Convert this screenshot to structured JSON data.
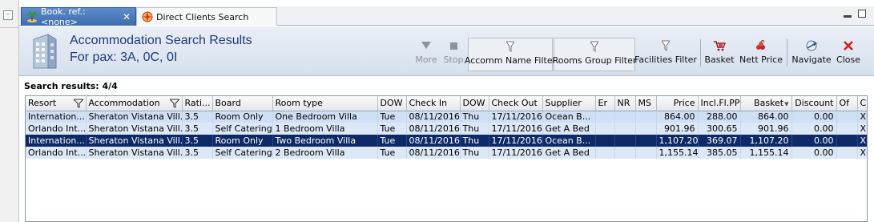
{
  "tabs": [
    {
      "label": "Book. ref.: <none>",
      "icon": "palm-island-icon",
      "active": true,
      "close": "✕"
    },
    {
      "label": "Direct Clients Search",
      "icon": "compass-star-icon",
      "active": false
    }
  ],
  "header": {
    "title": "Accommodation Search Results",
    "subtitle": "For pax: 3A, 0C, 0I"
  },
  "toolbar": {
    "more": "More",
    "stop": "Stop",
    "accomm_name_filter": "Accomm Name Filter",
    "rooms_group_filter": "Rooms Group Filter",
    "facilities_filter": "Facilities Filter",
    "basket": "Basket",
    "nett_price": "Nett Price",
    "navigate": "Navigate",
    "close": "Close"
  },
  "results_label": "Search results: 4/4",
  "columns": [
    "Resort",
    "Accommodation",
    "Rati...",
    "Board",
    "Room type",
    "DOW",
    "Check In",
    "DOW",
    "Check Out",
    "Supplier",
    "Er",
    "NR",
    "MS",
    "Price",
    "Incl.Fl.PP",
    "Basket",
    "Discount",
    "Of",
    "C"
  ],
  "rows": [
    [
      "Internation...",
      "Sheraton Vistana Vill...",
      "3.5",
      "Room Only",
      "One Bedroom Villa",
      "Tue",
      "08/11/2016",
      "Thu",
      "17/11/2016",
      "Ocean B...",
      "",
      "",
      "",
      "864.00",
      "288.00",
      "864.00",
      "0.00",
      "",
      "X"
    ],
    [
      "Orlando Int...",
      "Sheraton Vistana Vill...",
      "3.5",
      "Self Catering",
      "1 Bedroom Villa",
      "Tue",
      "08/11/2016",
      "Thu",
      "17/11/2016",
      "Get A Bed",
      "",
      "",
      "",
      "901.96",
      "300.65",
      "901.96",
      "0.00",
      "",
      "X"
    ],
    [
      "Internation...",
      "Sheraton Vistana Vill...",
      "3.5",
      "Room Only",
      "Two Bedroom Villa",
      "Tue",
      "08/11/2016",
      "Thu",
      "17/11/2016",
      "Ocean B...",
      "",
      "",
      "",
      "1,107.20",
      "369.07",
      "1,107.20",
      "0.00",
      "",
      "X"
    ],
    [
      "Orlando Int...",
      "Sheraton Vistana Vill...",
      "3.5",
      "Self Catering",
      "2 Bedroom Villa",
      "Tue",
      "08/11/2016",
      "Thu",
      "17/11/2016",
      "Get A Bed",
      "",
      "",
      "",
      "1,155.14",
      "385.05",
      "1,155.14",
      "0.00",
      "",
      "X"
    ]
  ],
  "colors": {
    "selected_row": "#0e2a66",
    "row": "#cfe0f4",
    "title": "#1f3a78"
  }
}
